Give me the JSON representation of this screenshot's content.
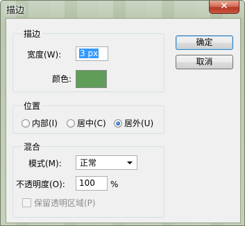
{
  "window": {
    "title": "描边",
    "close_glyph": "✕"
  },
  "stroke_group": {
    "label": "描边",
    "width_label": "宽度(W):",
    "width_value": "3 px",
    "color_label": "颜色:",
    "color_value": "#5f9d59"
  },
  "position_group": {
    "label": "位置",
    "options": [
      {
        "label": "内部(I)",
        "selected": false
      },
      {
        "label": "居中(C)",
        "selected": false
      },
      {
        "label": "居外(U)",
        "selected": true
      }
    ]
  },
  "blend_group": {
    "label": "混合",
    "mode_label": "模式(M):",
    "mode_value": "正常",
    "opacity_label": "不透明度(O):",
    "opacity_value": "100",
    "opacity_unit": "%",
    "preserve_label": "保留透明区域(P)",
    "preserve_checked": false
  },
  "buttons": {
    "ok": "确定",
    "cancel": "取消"
  }
}
